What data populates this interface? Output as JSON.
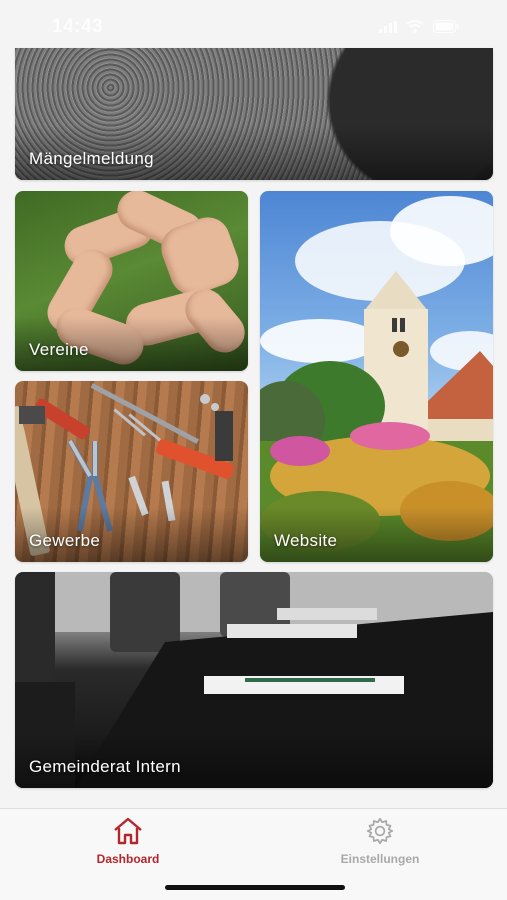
{
  "status_bar": {
    "time": "14:43"
  },
  "tiles": {
    "maengelmeldung": "Mängelmeldung",
    "vereine": "Vereine",
    "gewerbe": "Gewerbe",
    "website": "Website",
    "gemeinderat": "Gemeinderat Intern"
  },
  "tabbar": {
    "items": [
      {
        "label": "Dashboard",
        "icon": "home-icon",
        "active": true
      },
      {
        "label": "Einstellungen",
        "icon": "gear-icon",
        "active": false
      }
    ]
  },
  "colors": {
    "accent": "#b3262b",
    "inactive": "#a9a9a9",
    "background": "#f4f4f4"
  }
}
